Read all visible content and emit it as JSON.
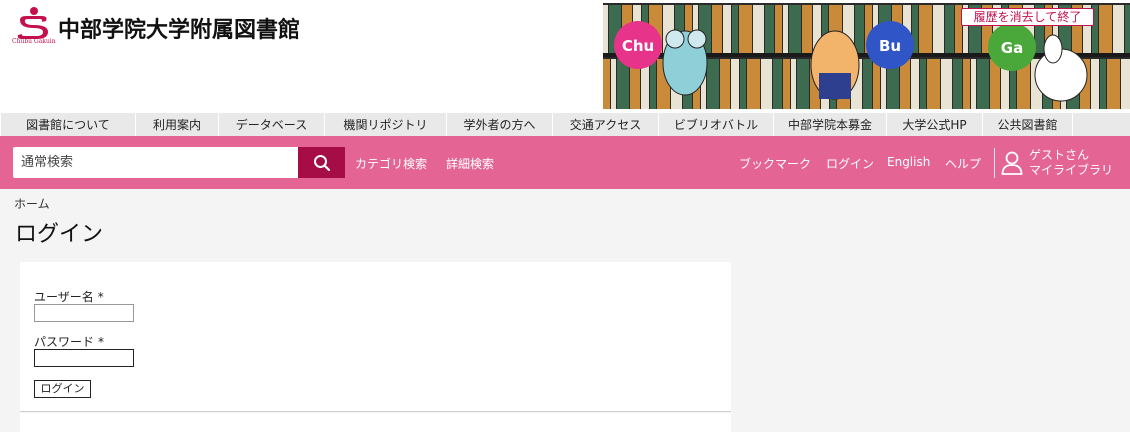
{
  "header": {
    "library_name": "中部学院大学附属図書館",
    "logo_sub": "Chubu Gakuin",
    "logout_label": "履歴を消去して終了",
    "banner_bubbles": [
      "Chu",
      "Bu",
      "Ga"
    ],
    "colors": {
      "brand": "#c4104f",
      "bubble_pink": "#e8338a",
      "bubble_blue": "#2f55c7",
      "bubble_green": "#4aa83a"
    }
  },
  "topnav": [
    "図書館について",
    "利用案内",
    "データベース",
    "機関リポジトリ",
    "学外者の方へ",
    "交通アクセス",
    "ビブリオバトル",
    "中部学院本募金",
    "大学公式HP",
    "公共図書館"
  ],
  "searchbar": {
    "placeholder": "通常検索",
    "links": [
      "カテゴリ検索",
      "詳細検索"
    ],
    "right_links": [
      "ブックマーク",
      "ログイン",
      "English",
      "ヘルプ"
    ],
    "user_line1": "ゲストさん",
    "user_line2": "マイライブラリ",
    "colors": {
      "bar": "#e46594",
      "button": "#a60c45"
    }
  },
  "breadcrumb": "ホーム",
  "page_title": "ログイン",
  "form": {
    "username_label": "ユーザー名",
    "password_label": "パスワード",
    "required_mark": "*",
    "username_value": "",
    "password_value": "",
    "submit_label": "ログイン"
  }
}
